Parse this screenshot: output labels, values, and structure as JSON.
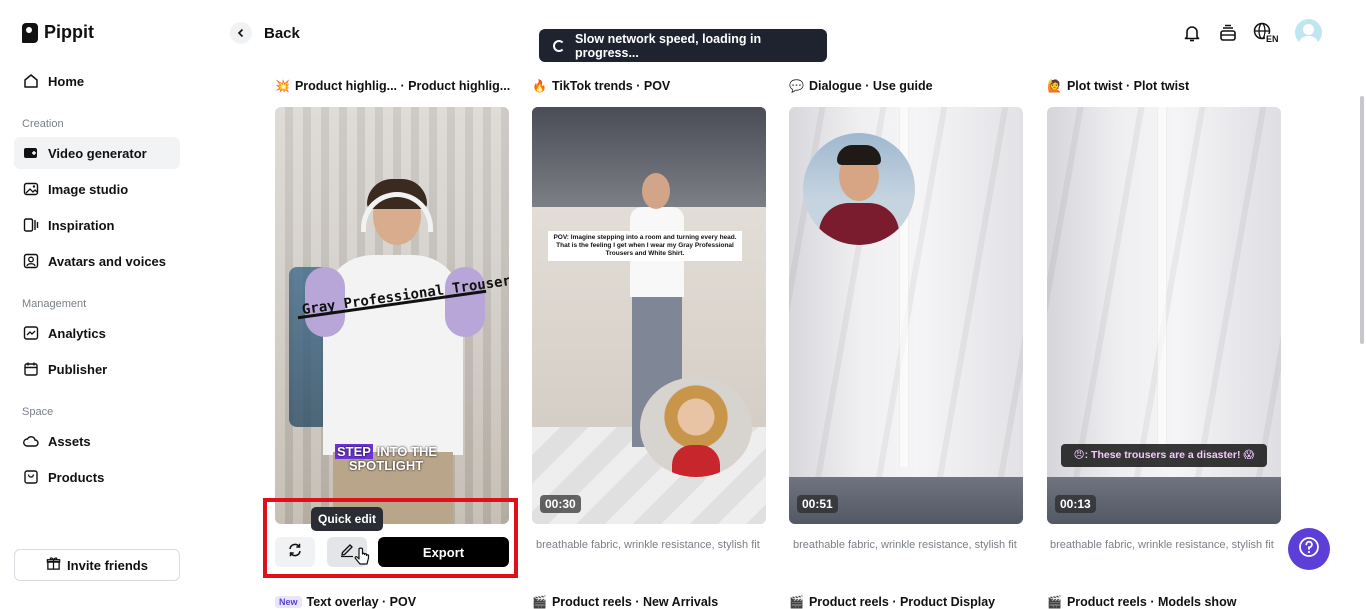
{
  "app": {
    "name": "Pippit"
  },
  "sidebar": {
    "home": "Home",
    "creation_label": "Creation",
    "creation": [
      {
        "label": "Video generator"
      },
      {
        "label": "Image studio"
      },
      {
        "label": "Inspiration"
      },
      {
        "label": "Avatars and voices"
      }
    ],
    "management_label": "Management",
    "management": [
      {
        "label": "Analytics"
      },
      {
        "label": "Publisher"
      }
    ],
    "space_label": "Space",
    "space": [
      {
        "label": "Assets"
      },
      {
        "label": "Products"
      }
    ],
    "invite": "Invite friends"
  },
  "header": {
    "back": "Back",
    "toast": "Slow network speed, loading in progress...",
    "lang": "EN"
  },
  "cards": [
    {
      "emoji": "💥",
      "title": "Product highlig... · Product highlig...",
      "overlay": "Gray Professional Trousers",
      "step": "STEP",
      "step_rest": "INTO THE",
      "spotlight": "SPOTLIGHT"
    },
    {
      "emoji": "🔥",
      "title": "TikTok trends · POV",
      "caption": "POV: Imagine stepping into a room and turning every head. That is the feeling I get when I wear my Gray Professional Trousers and White Shirt.",
      "duration": "00:30",
      "desc": "breathable fabric, wrinkle resistance, stylish fit"
    },
    {
      "emoji": "💬",
      "title": "Dialogue · Use guide",
      "duration": "00:51",
      "desc": "breathable fabric, wrinkle resistance, stylish fit"
    },
    {
      "emoji": "🙋",
      "title": "Plot twist · Plot twist",
      "subtitle": "😠: These trousers are a disaster! 😱",
      "duration": "00:13",
      "desc": "breathable fabric, wrinkle resistance, stylish fit"
    }
  ],
  "actions": {
    "tooltip": "Quick edit",
    "export": "Export"
  },
  "row2": [
    {
      "badge": "New",
      "title": "Text overlay · POV"
    },
    {
      "emoji": "🎬",
      "title": "Product reels · New Arrivals"
    },
    {
      "emoji": "🎬",
      "title": "Product reels · Product Display"
    },
    {
      "emoji": "🎬",
      "title": "Product reels · Models show"
    }
  ],
  "colors": {
    "accent": "#5b3fd6",
    "highlight_box": "#e0101a",
    "toast_bg": "#1f2330"
  }
}
